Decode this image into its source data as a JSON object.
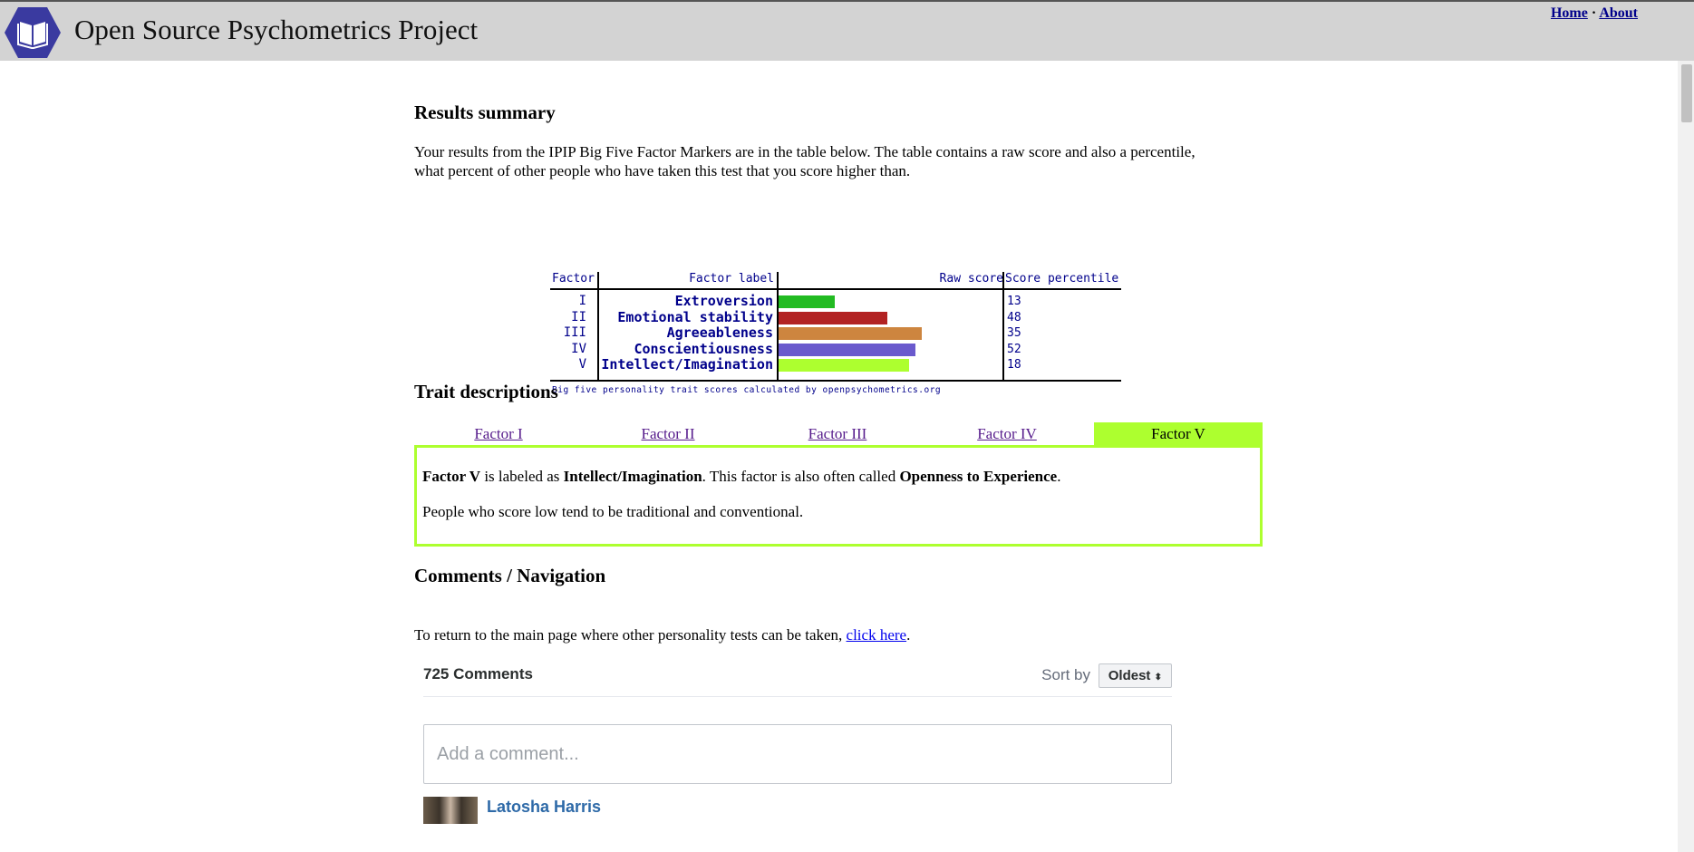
{
  "header": {
    "site_title": "Open Source Psychometrics Project",
    "home_link": "Home",
    "separator": "·",
    "about_link": "About"
  },
  "results": {
    "heading": "Results summary",
    "intro_line1": "Your results from the IPIP Big Five Factor Markers are in the table below. The table contains a raw score and also a percentile,",
    "intro_line2": "what percent of other people who have taken this test that you score higher than."
  },
  "chart_data": {
    "type": "bar",
    "columns": {
      "factor": "Factor",
      "factor_label": "Factor label",
      "raw_score": "Raw score",
      "score_percentile": "Score percentile"
    },
    "rows": [
      {
        "factor": "I",
        "label": "Extroversion",
        "raw_score": 13,
        "percentile": "13",
        "color": "#22bb22"
      },
      {
        "factor": "II",
        "label": "Emotional stability",
        "raw_score": 25,
        "percentile": "48",
        "color": "#b22222"
      },
      {
        "factor": "III",
        "label": "Agreeableness",
        "raw_score": 33,
        "percentile": "35",
        "color": "#cd853f"
      },
      {
        "factor": "IV",
        "label": "Conscientiousness",
        "raw_score": 31.5,
        "percentile": "52",
        "color": "#6a5acd"
      },
      {
        "factor": "V",
        "label": "Intellect/Imagination",
        "raw_score": 30,
        "percentile": "18",
        "color": "#adff2f"
      }
    ],
    "raw_score_max": 50,
    "credit": "Big five personality trait scores calculated by openpsychometrics.org"
  },
  "traits": {
    "heading": "Trait descriptions",
    "tabs": [
      "Factor I",
      "Factor II",
      "Factor III",
      "Factor IV",
      "Factor V"
    ],
    "active_tab": 4,
    "desc_b1": "Factor V",
    "desc_t1": " is labeled as ",
    "desc_b2": "Intellect/Imagination",
    "desc_t2": ". This factor is also often called ",
    "desc_b3": "Openness to Experience",
    "desc_t3": ".",
    "desc_line2": "People who score low tend to be traditional and conventional."
  },
  "comments_nav": {
    "heading": "Comments / Navigation",
    "return_text": "To return to the main page where other personality tests can be taken, ",
    "return_link": "click here",
    "return_end": "."
  },
  "comments": {
    "count_label": "725 Comments",
    "sort_label": "Sort by",
    "sort_value": "Oldest",
    "input_placeholder": "Add a comment...",
    "first_author": "Latosha Harris"
  }
}
